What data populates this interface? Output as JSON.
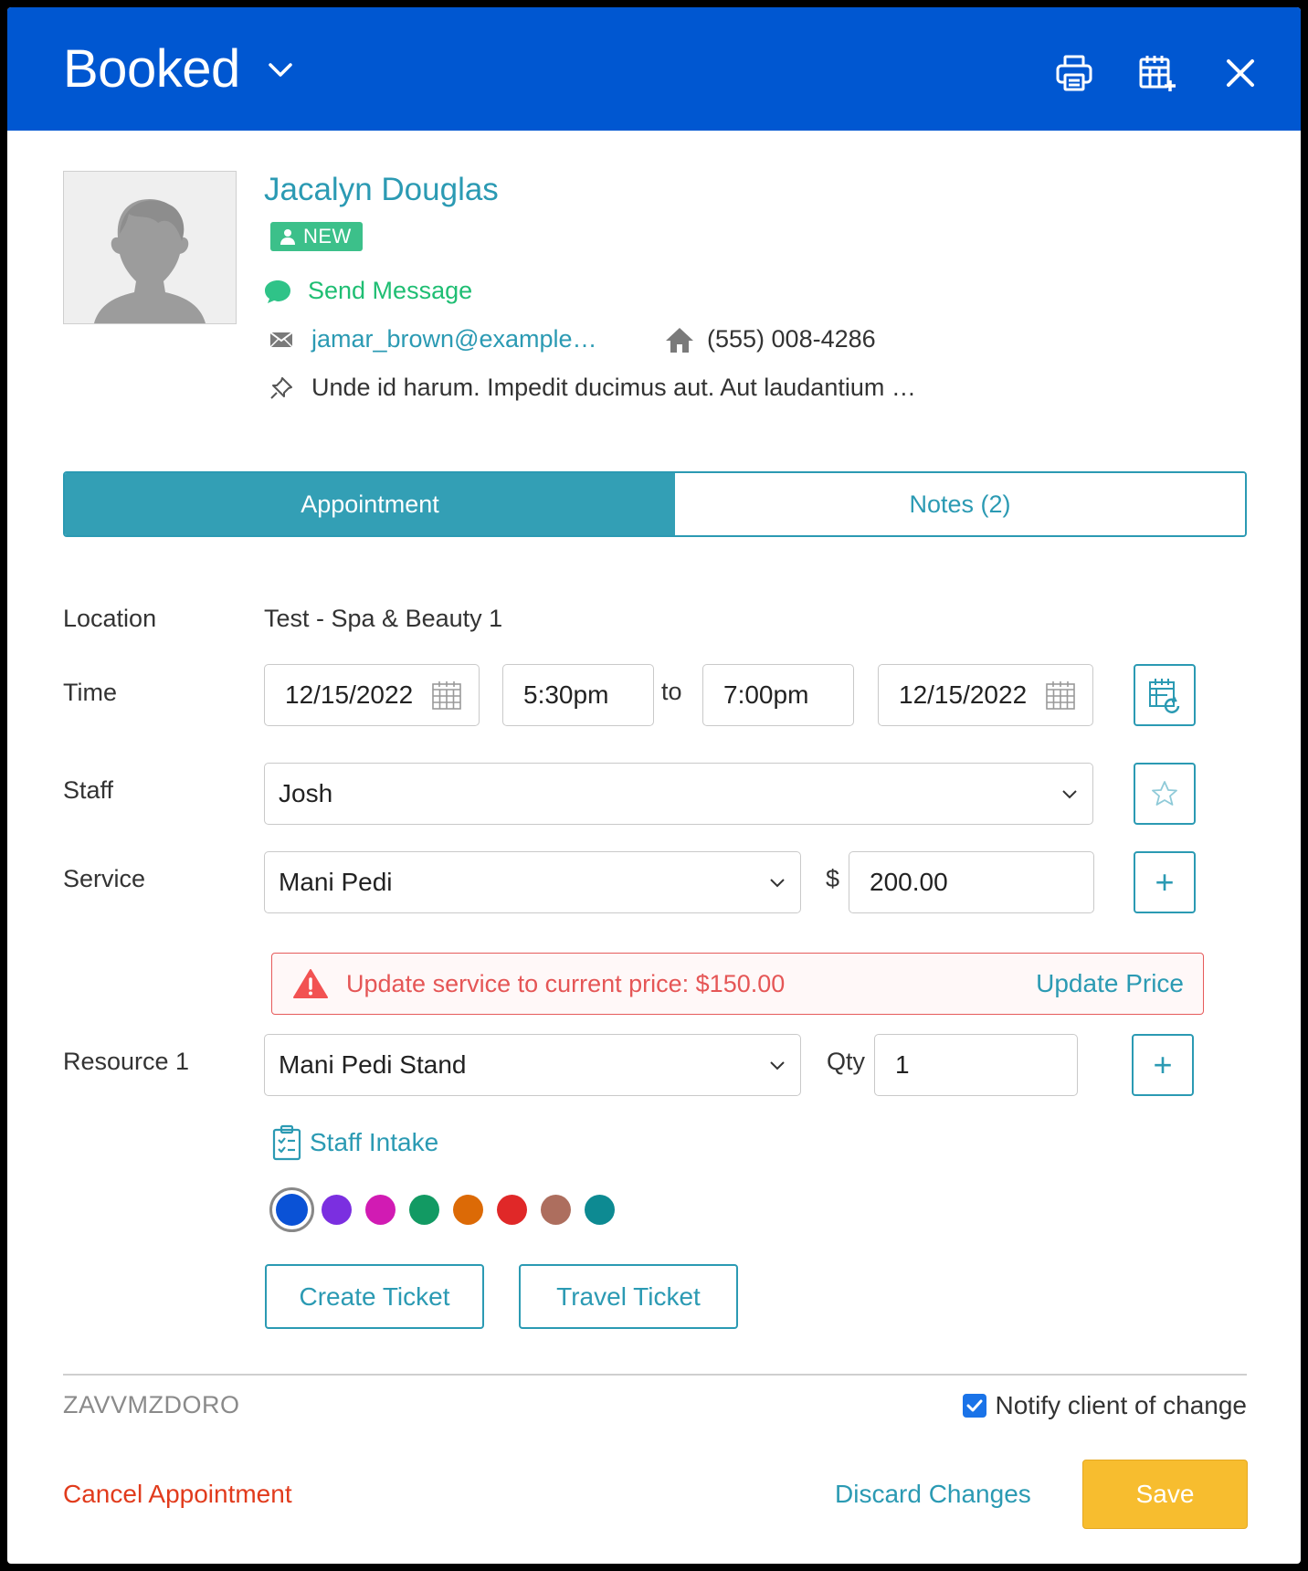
{
  "header": {
    "status": "Booked",
    "icons": [
      "print-icon",
      "calendar-add-icon",
      "close-icon"
    ],
    "bg_color": "#0057d1"
  },
  "client": {
    "name": "Jacalyn Douglas",
    "badge": "NEW",
    "send_message": "Send Message",
    "email": "jamar_brown@example…",
    "phone": "(555) 008-4286",
    "address": "Unde id harum. Impedit ducimus aut. Aut laudantium …"
  },
  "tabs": {
    "appointment": "Appointment",
    "notes": "Notes (2)"
  },
  "form": {
    "location_label": "Location",
    "location_value": "Test - Spa & Beauty 1",
    "time_label": "Time",
    "start_date": "12/15/2022",
    "start_time": "5:30pm",
    "to_label": "to",
    "end_time": "7:00pm",
    "end_date": "12/15/2022",
    "staff_label": "Staff",
    "staff_value": "Josh",
    "service_label": "Service",
    "service_value": "Mani Pedi",
    "currency": "$",
    "price": "200.00",
    "warning_text": "Update service to current price: $150.00",
    "update_price": "Update Price",
    "resource_label": "Resource 1",
    "resource_value": "Mani Pedi Stand",
    "qty_label": "Qty",
    "qty_value": "1",
    "staff_intake": "Staff Intake"
  },
  "colors": [
    "#0a52d6",
    "#7b2fe0",
    "#d11bb3",
    "#129a63",
    "#dc6a06",
    "#e02828",
    "#ad6e5e",
    "#0d8a92"
  ],
  "buttons": {
    "create_ticket": "Create Ticket",
    "travel_ticket": "Travel Ticket"
  },
  "footer": {
    "code": "ZAVVMZDORO",
    "notify": "Notify client of change",
    "cancel": "Cancel Appointment",
    "discard": "Discard Changes",
    "save": "Save"
  }
}
